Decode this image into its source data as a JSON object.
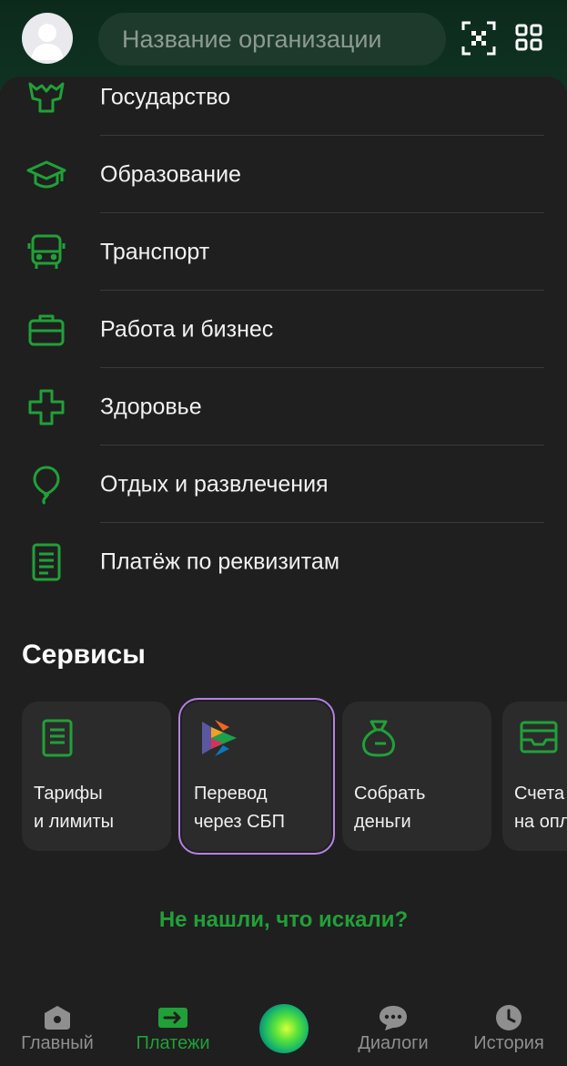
{
  "header": {
    "search_placeholder": "Название организации",
    "icons": [
      "avatar",
      "qr-scan-icon",
      "grid-icon"
    ]
  },
  "categories": [
    {
      "label": "Государство",
      "icon": "state-emblem-icon"
    },
    {
      "label": "Образование",
      "icon": "graduation-cap-icon"
    },
    {
      "label": "Транспорт",
      "icon": "bus-icon"
    },
    {
      "label": "Работа и бизнес",
      "icon": "briefcase-icon"
    },
    {
      "label": "Здоровье",
      "icon": "medical-cross-icon"
    },
    {
      "label": "Отдых и развлечения",
      "icon": "balloon-icon"
    },
    {
      "label": "Платёж по реквизитам",
      "icon": "document-icon"
    }
  ],
  "services": {
    "title": "Сервисы",
    "cards": [
      {
        "line1": "Тарифы",
        "line2": "и лимиты",
        "icon": "tariff-document-icon"
      },
      {
        "line1": "Перевод",
        "line2": "через СБП",
        "icon": "sbp-logo-icon"
      },
      {
        "line1": "Собрать",
        "line2": "деньги",
        "icon": "money-bag-icon"
      },
      {
        "line1": "Счета",
        "line2": "на опл",
        "icon": "invoice-tray-icon"
      }
    ]
  },
  "not_found_link": "Не нашли, что искали?",
  "bottom_nav": [
    {
      "label": "Главный",
      "icon": "home-icon",
      "active": false
    },
    {
      "label": "Платежи",
      "icon": "payments-arrow-icon",
      "active": true
    },
    {
      "label": "",
      "icon": "assistant-orb-icon",
      "active": false
    },
    {
      "label": "Диалоги",
      "icon": "chat-bubble-icon",
      "active": false
    },
    {
      "label": "История",
      "icon": "clock-icon",
      "active": false
    }
  ],
  "colors": {
    "accent_green": "#21a038",
    "background": "#1f1f1f",
    "card": "#2b2b2b",
    "header": "#0f3322",
    "selection_outline": "#b680e6"
  }
}
